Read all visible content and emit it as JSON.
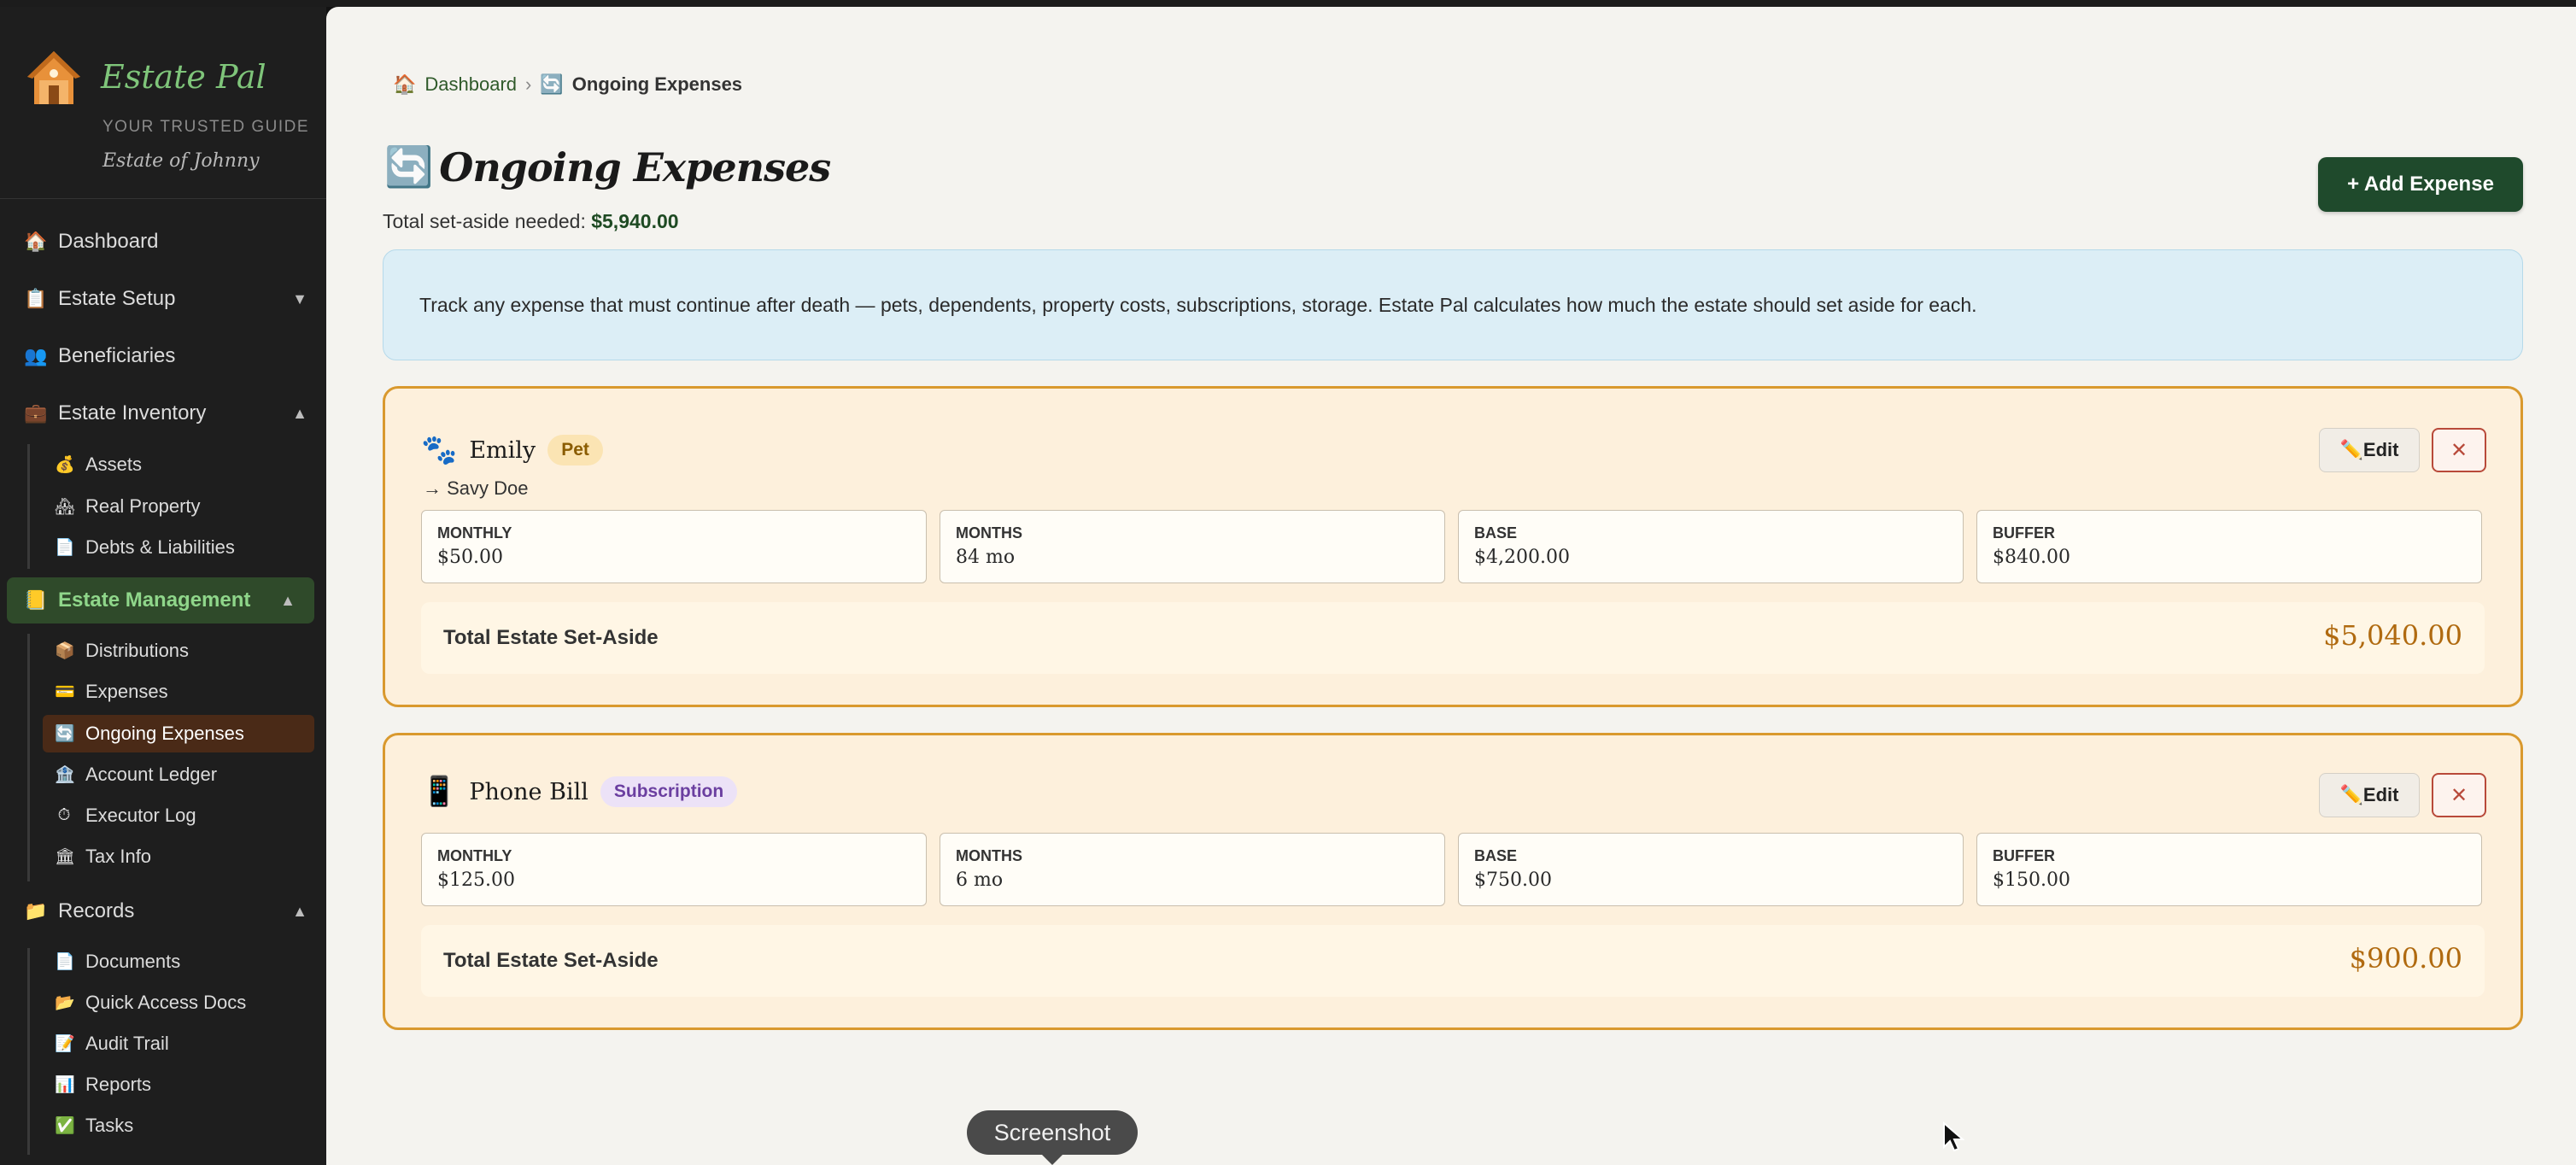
{
  "brand": {
    "title": "Estate Pal",
    "tagline": "YOUR TRUSTED GUIDE",
    "estate_name": "Estate of Johnny"
  },
  "sidebar": {
    "top": [
      {
        "icon": "🏠",
        "label": "Dashboard"
      },
      {
        "icon": "📋",
        "label": "Estate Setup",
        "caret": "▼"
      },
      {
        "icon": "👥",
        "label": "Beneficiaries"
      },
      {
        "icon": "💼",
        "label": "Estate Inventory",
        "caret": "▲"
      }
    ],
    "inventory": [
      {
        "icon": "💰",
        "label": "Assets"
      },
      {
        "icon": "🏘",
        "label": "Real Property"
      },
      {
        "icon": "📄",
        "label": "Debts & Liabilities"
      }
    ],
    "management": {
      "icon": "📒",
      "label": "Estate Management",
      "caret": "▲"
    },
    "management_items": [
      {
        "icon": "📦",
        "label": "Distributions"
      },
      {
        "icon": "💳",
        "label": "Expenses"
      },
      {
        "icon": "🔄",
        "label": "Ongoing Expenses"
      },
      {
        "icon": "🏦",
        "label": "Account Ledger"
      },
      {
        "icon": "⏱",
        "label": "Executor Log"
      },
      {
        "icon": "🏛",
        "label": "Tax Info"
      }
    ],
    "records": {
      "icon": "📁",
      "label": "Records",
      "caret": "▲"
    },
    "records_items": [
      {
        "icon": "📄",
        "label": "Documents"
      },
      {
        "icon": "📂",
        "label": "Quick Access Docs"
      },
      {
        "icon": "📝",
        "label": "Audit Trail"
      },
      {
        "icon": "📊",
        "label": "Reports"
      },
      {
        "icon": "✅",
        "label": "Tasks"
      }
    ]
  },
  "breadcrumb": {
    "home_icon": "🏠",
    "home": "Dashboard",
    "separator": "›",
    "current_icon": "🔄",
    "current": "Ongoing Expenses"
  },
  "page": {
    "title_icon": "🔄",
    "title": "Ongoing Expenses",
    "subtotal_label": "Total set-aside needed:",
    "subtotal_value": "$5,940.00",
    "add_button": "+ Add Expense",
    "info": "Track any expense that must continue after death — pets, dependents, property costs, subscriptions, storage. Estate Pal calculates how much the estate should set aside for each."
  },
  "expenses": [
    {
      "icon": "🐾",
      "name": "Emily",
      "badge": "Pet",
      "recipient": "→ Savy Doe",
      "edit_label": "✏️Edit",
      "delete_label": "✕",
      "stats": [
        {
          "label": "MONTHLY",
          "value": "$50.00"
        },
        {
          "label": "MONTHS",
          "value": "84 mo"
        },
        {
          "label": "BASE",
          "value": "$4,200.00"
        },
        {
          "label": "BUFFER",
          "value": "$840.00"
        }
      ],
      "total_label": "Total Estate Set-Aside",
      "total_value": "$5,040.00"
    },
    {
      "icon": "📱",
      "name": "Phone Bill",
      "badge": "Subscription",
      "edit_label": "✏️Edit",
      "delete_label": "✕",
      "stats": [
        {
          "label": "MONTHLY",
          "value": "$125.00"
        },
        {
          "label": "MONTHS",
          "value": "6 mo"
        },
        {
          "label": "BASE",
          "value": "$750.00"
        },
        {
          "label": "BUFFER",
          "value": "$150.00"
        }
      ],
      "total_label": "Total Estate Set-Aside",
      "total_value": "$900.00"
    }
  ],
  "overlay": {
    "tooltip": "Screenshot"
  },
  "colors": {
    "accent_green": "#1f4a2c",
    "card_border": "#d9992e",
    "total_value": "#b06a10"
  }
}
